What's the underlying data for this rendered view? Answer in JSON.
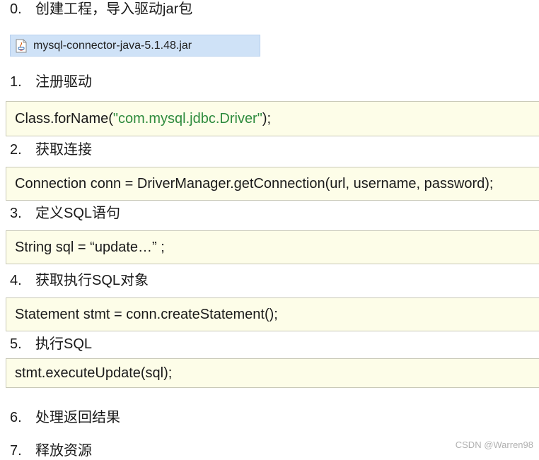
{
  "steps": [
    {
      "num": "0.",
      "label": "创建工程，导入驱动jar包"
    },
    {
      "num": "1.",
      "label": "注册驱动"
    },
    {
      "num": "2.",
      "label": "获取连接"
    },
    {
      "num": "3.",
      "label": "定义SQL语句"
    },
    {
      "num": "4.",
      "label": "获取执行SQL对象"
    },
    {
      "num": "5.",
      "label": "执行SQL"
    },
    {
      "num": "6.",
      "label": "处理返回结果"
    },
    {
      "num": "7.",
      "label": "释放资源"
    }
  ],
  "jar_file": {
    "icon": "jar-file-icon",
    "name": "mysql-connector-java-5.1.48.jar"
  },
  "code": {
    "register": {
      "prefix": "Class.forName(",
      "string": "\"com.mysql.jdbc.Driver\"",
      "suffix": ");"
    },
    "connection": "Connection conn = DriverManager.getConnection(url, username, password);",
    "sql": "String sql = “update…” ;",
    "statement": "Statement stmt = conn.createStatement();",
    "execute": "stmt.executeUpdate(sql);"
  },
  "colors": {
    "code_background": "#fdfde8",
    "string_literal": "#2e8b3d",
    "file_bar": "#cfe2f7"
  },
  "watermark": "CSDN @Warren98"
}
